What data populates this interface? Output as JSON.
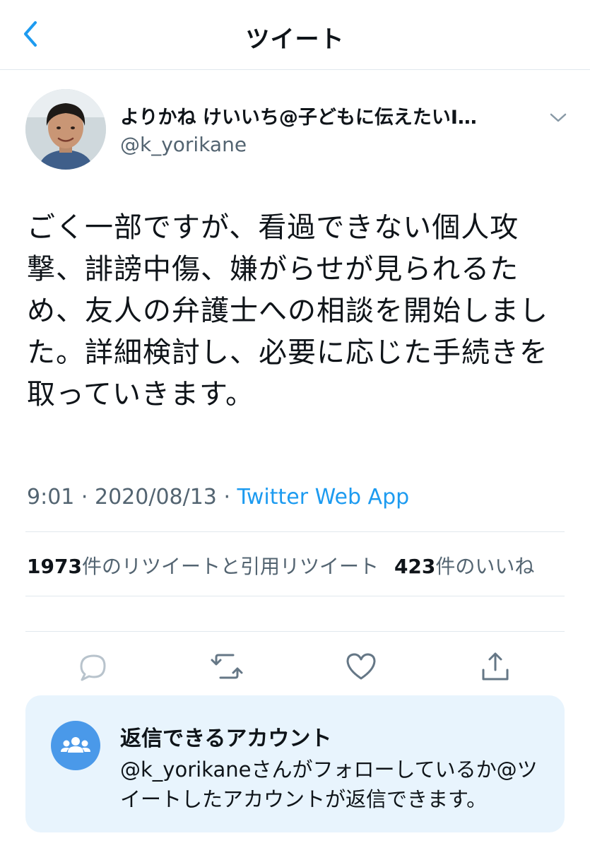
{
  "header": {
    "title": "ツイート",
    "back_icon": "chevron-left-icon"
  },
  "author": {
    "display_name": "よりかね けいいち@子どもに伝えたいI…",
    "handle": "@k_yorikane"
  },
  "tweet": {
    "text": "ごく一部ですが、看過できない個人攻撃、誹謗中傷、嫌がらせが見られるため、友人の弁護士への相談を開始しました。詳細検討し、必要に応じた手続きを取っていきます。",
    "time": "9:01",
    "date": "2020/08/13",
    "separator": " · ",
    "source": "Twitter Web App"
  },
  "stats": {
    "retweet_count": "1973",
    "retweet_label": "件のリツイートと引用リツイート",
    "like_count": "423",
    "like_label": "件のいいね"
  },
  "actions": [
    "reply-icon",
    "retweet-icon",
    "like-icon",
    "share-icon"
  ],
  "reply_settings": {
    "title": "返信できるアカウント",
    "description": "@k_yorikaneさんがフォローしているか@ツイートしたアカウントが返信できます。",
    "icon": "people-icon"
  },
  "colors": {
    "accent": "#1d9bf0",
    "secondary_text": "#536471",
    "panel_bg": "#e8f4fd",
    "icon_circle": "#4a99e9"
  }
}
